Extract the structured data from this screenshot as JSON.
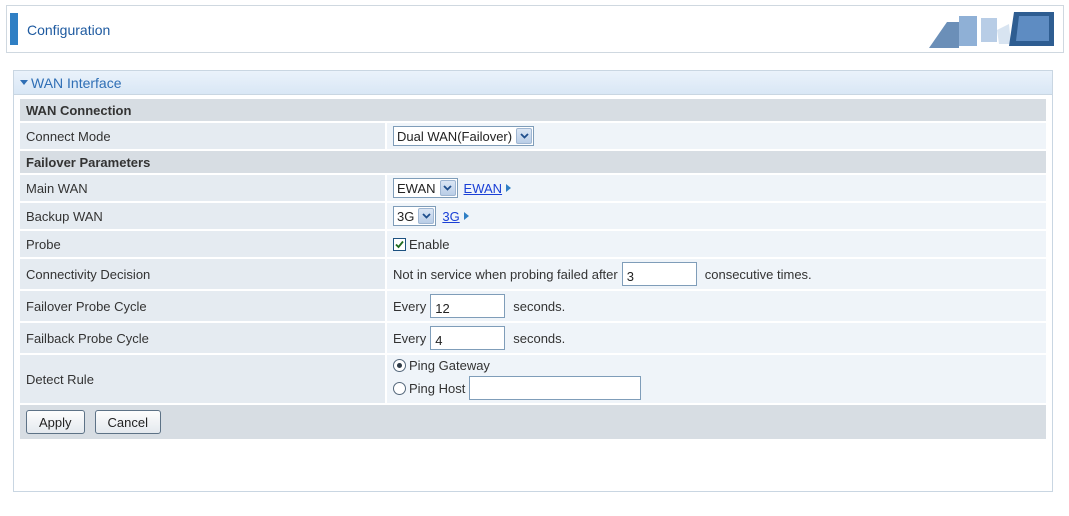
{
  "header": {
    "title": "Configuration"
  },
  "panel": {
    "title": "WAN Interface"
  },
  "sections": {
    "wan_connection": "WAN Connection",
    "failover_parameters": "Failover Parameters"
  },
  "connect_mode": {
    "label": "Connect Mode",
    "value": "Dual WAN(Failover)"
  },
  "main_wan": {
    "label": "Main WAN",
    "value": "EWAN",
    "link": "EWAN"
  },
  "backup_wan": {
    "label": "Backup WAN",
    "value": "3G",
    "link": "3G"
  },
  "probe": {
    "label": "Probe",
    "checkbox_label": "Enable",
    "checked": true
  },
  "connectivity": {
    "label": "Connectivity Decision",
    "prefix": "Not in service when probing failed after",
    "value": "3",
    "suffix": "consecutive times."
  },
  "failover_cycle": {
    "label": "Failover Probe Cycle",
    "prefix": "Every",
    "value": "12",
    "suffix": "seconds."
  },
  "failback_cycle": {
    "label": "Failback Probe Cycle",
    "prefix": "Every",
    "value": "4",
    "suffix": "seconds."
  },
  "detect_rule": {
    "label": "Detect Rule",
    "options": [
      {
        "label": "Ping Gateway",
        "selected": true
      },
      {
        "label": "Ping Host",
        "selected": false
      }
    ],
    "host_value": ""
  },
  "buttons": {
    "apply": "Apply",
    "cancel": "Cancel"
  },
  "colors": {
    "accent": "#2f7fc4",
    "link": "#1a3fd6",
    "panel_title": "#2f6fb5"
  },
  "icons": {
    "select_arrow": "chevron-down-icon",
    "link_caret": "caret-right-icon"
  }
}
